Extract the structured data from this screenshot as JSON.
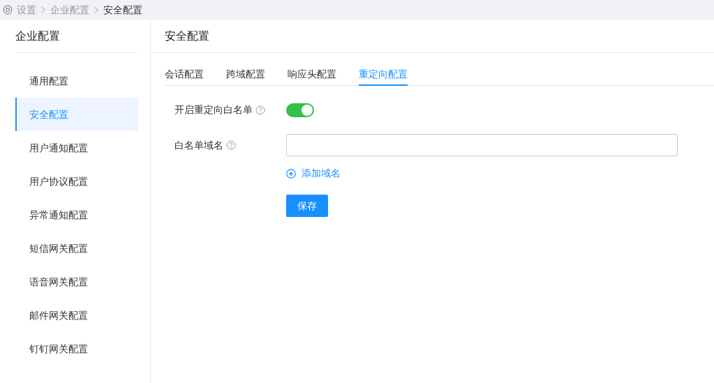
{
  "breadcrumb": [
    "设置",
    "企业配置",
    "安全配置"
  ],
  "sidebar": {
    "title": "企业配置",
    "items": [
      {
        "label": "通用配置",
        "selected": false
      },
      {
        "label": "安全配置",
        "selected": true
      },
      {
        "label": "用户通知配置",
        "selected": false
      },
      {
        "label": "用户协议配置",
        "selected": false
      },
      {
        "label": "异常通知配置",
        "selected": false
      },
      {
        "label": "短信网关配置",
        "selected": false
      },
      {
        "label": "语音网关配置",
        "selected": false
      },
      {
        "label": "邮件网关配置",
        "selected": false
      },
      {
        "label": "钉钉网关配置",
        "selected": false
      }
    ]
  },
  "main": {
    "title": "安全配置",
    "tabs": [
      {
        "label": "会话配置",
        "selected": false
      },
      {
        "label": "跨域配置",
        "selected": false
      },
      {
        "label": "响应头配置",
        "selected": false
      },
      {
        "label": "重定向配置",
        "selected": true
      }
    ],
    "form": {
      "whitelist_switch": {
        "label": "开启重定向白名单",
        "on": true
      },
      "domain": {
        "label": "白名单域名"
      },
      "add_link": "添加域名",
      "save_button": "保存"
    }
  }
}
